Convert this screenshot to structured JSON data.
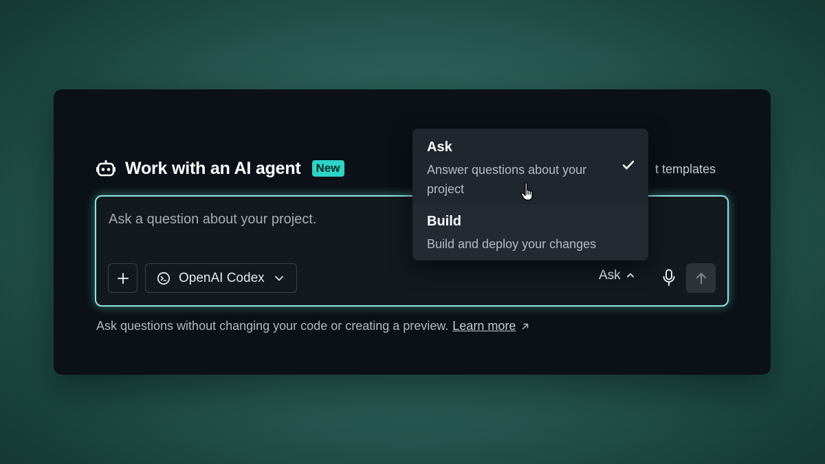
{
  "header": {
    "title": "Work with an AI agent",
    "badge": "New",
    "templates_text": "t templates"
  },
  "composer": {
    "placeholder": "Ask a question about your project.",
    "model_label": "OpenAI Codex",
    "mode_label": "Ask"
  },
  "footer": {
    "text": "Ask questions without changing your code or creating a preview.",
    "link": "Learn more"
  },
  "mode_menu": {
    "items": [
      {
        "title": "Ask",
        "description": "Answer questions about your project",
        "selected": true
      },
      {
        "title": "Build",
        "description": "Build and deploy your changes",
        "selected": false
      }
    ]
  },
  "colors": {
    "accent": "#2dd4c8",
    "composer_border": "#8fe7e3",
    "card_bg": "#0b1116"
  }
}
